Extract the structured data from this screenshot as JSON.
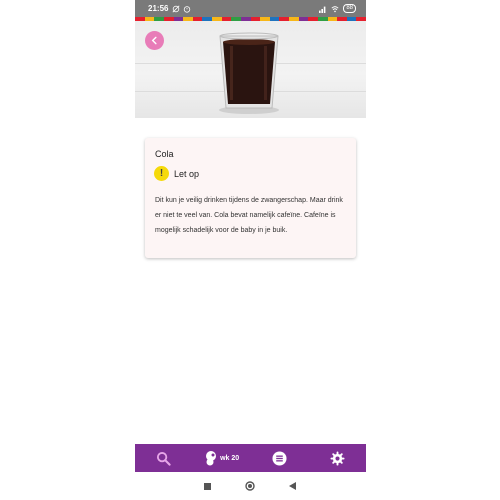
{
  "status_bar": {
    "time": "21:56",
    "battery": "88"
  },
  "stripe_colors": [
    "#e5202e",
    "#f7b718",
    "#2f9e44",
    "#e5202e",
    "#7e2f95",
    "#f7b718",
    "#e5202e",
    "#1e73be",
    "#f7b718",
    "#e5202e",
    "#2f9e44",
    "#7e2f95",
    "#e5202e",
    "#f7b718",
    "#1e73be",
    "#e5202e",
    "#f7b718",
    "#7e2f95",
    "#e5202e",
    "#2f9e44",
    "#f7b718",
    "#e5202e",
    "#1e73be",
    "#e5202e"
  ],
  "hero": {
    "image": "glass-of-cola",
    "back_icon": "chevron-left-icon"
  },
  "card": {
    "title": "Cola",
    "status_icon": "exclamation-icon",
    "status_label": "Let op",
    "body": "Dit kun je veilig drinken tijdens de zwangerschap. Maar drink er niet te veel van. Cola bevat namelijk cafeïne. Cafeïne is mogelijk schadelijk voor de baby in je buik."
  },
  "bottom_nav": {
    "items": [
      {
        "icon": "search-icon"
      },
      {
        "icon": "baby-icon",
        "label": "wk 20"
      },
      {
        "icon": "list-icon"
      },
      {
        "icon": "gear-icon"
      }
    ]
  },
  "colors": {
    "nav_bg": "#7e2f95",
    "back_button": "#e87cb8",
    "warning": "#f5d90a"
  }
}
